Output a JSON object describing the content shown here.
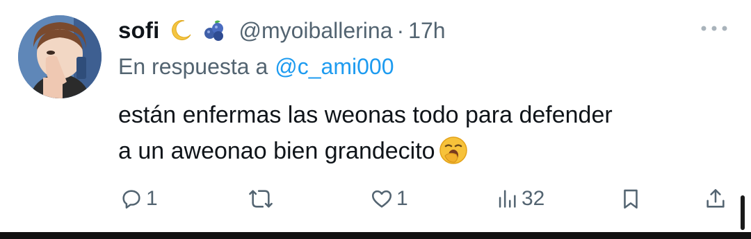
{
  "tweet": {
    "display_name": "sofi",
    "handle": "@myoiballerina",
    "separator": "·",
    "timestamp": "17h",
    "reply_prefix": "En respuesta a",
    "reply_to": "@c_ami000",
    "text_line_1": "están enfermas las weonas todo para defender",
    "text_line_2": "a un aweonao bien grandecito",
    "name_emojis": [
      "crescent-moon-icon",
      "blueberries-icon"
    ],
    "inline_emoji": "yawning-face-icon"
  },
  "actions": {
    "reply_count": "1",
    "retweet_count": "",
    "like_count": "1",
    "views_count": "32"
  },
  "colors": {
    "text": "#0f1419",
    "secondary": "#536471",
    "link": "#1d9bf0"
  }
}
